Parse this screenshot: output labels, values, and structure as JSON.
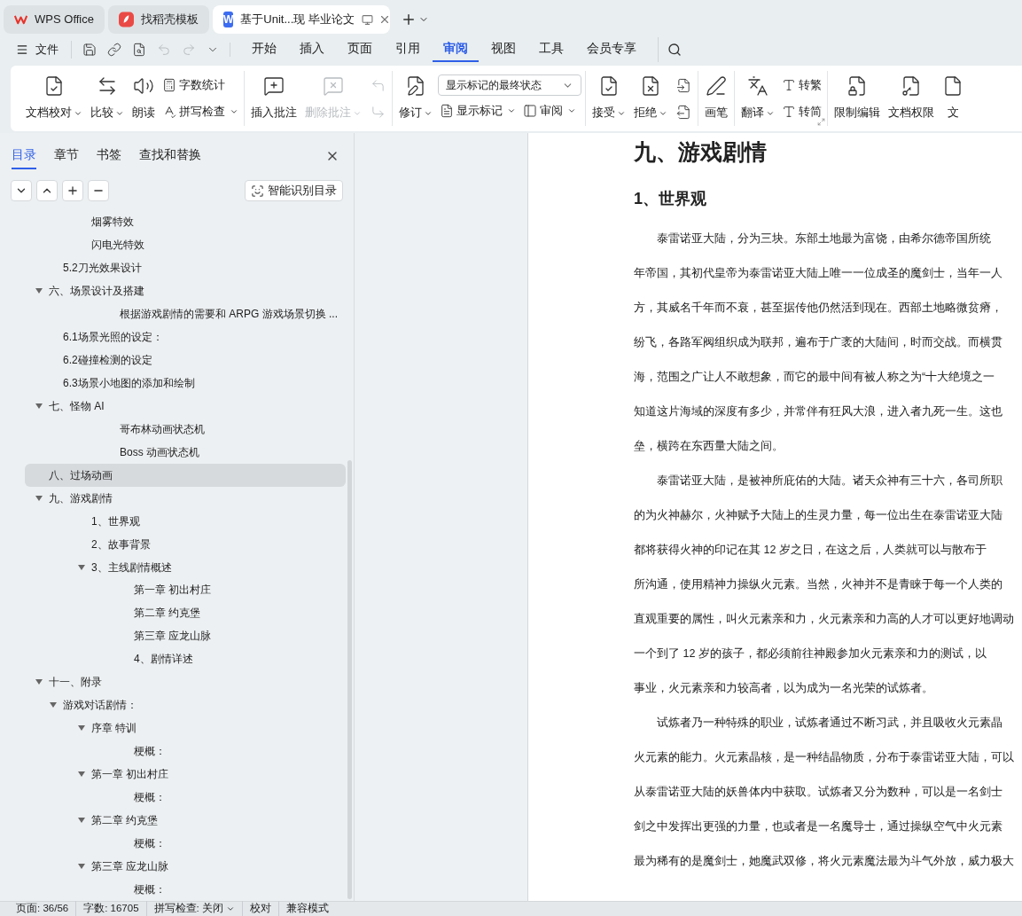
{
  "tabs": [
    {
      "label": "WPS Office",
      "selected": false,
      "kind": "home"
    },
    {
      "label": "找稻壳模板",
      "selected": false,
      "kind": "template"
    },
    {
      "label": "基于Unit...现 毕业论文",
      "selected": true,
      "kind": "document",
      "badge": "W"
    }
  ],
  "menu": {
    "file": "文件",
    "quick_access": [
      {
        "disabled": false
      },
      {
        "disabled": false
      },
      {
        "disabled": false
      },
      {
        "disabled": true
      },
      {
        "disabled": true
      },
      {
        "disabled": false
      }
    ],
    "tabs": [
      {
        "label": "开始",
        "selected": false
      },
      {
        "label": "插入",
        "selected": false
      },
      {
        "label": "页面",
        "selected": false
      },
      {
        "label": "引用",
        "selected": false
      },
      {
        "label": "审阅",
        "selected": true
      },
      {
        "label": "视图",
        "selected": false
      },
      {
        "label": "工具",
        "selected": false
      },
      {
        "label": "会员专享",
        "selected": false
      }
    ]
  },
  "ribbon": [
    {
      "launcher": false,
      "columns": [
        [
          [
            {
              "kind": "large",
              "label": "文档校对",
              "dropdown": true,
              "disabled": false
            }
          ]
        ],
        [
          [
            {
              "kind": "large",
              "label": "比较",
              "dropdown": true,
              "disabled": false
            }
          ]
        ],
        [
          [
            {
              "kind": "large",
              "label": "朗读",
              "dropdown": false,
              "disabled": false
            }
          ]
        ],
        [
          [
            {
              "kind": "small",
              "label": "字数统计",
              "dropdown": false,
              "disabled": false
            }
          ],
          [
            {
              "kind": "small",
              "label": "拼写检查",
              "dropdown": true,
              "disabled": false
            }
          ]
        ]
      ]
    },
    {
      "launcher": false,
      "columns": [
        [
          [
            {
              "kind": "large",
              "label": "插入批注",
              "dropdown": false,
              "disabled": false
            }
          ]
        ],
        [
          [
            {
              "kind": "large",
              "label": "删除批注",
              "dropdown": true,
              "disabled": true
            }
          ]
        ],
        [
          [
            {
              "kind": "icon",
              "disabled": true
            }
          ],
          [
            {
              "kind": "icon",
              "disabled": true
            }
          ]
        ]
      ]
    },
    {
      "launcher": false,
      "columns": [
        [
          [
            {
              "kind": "large",
              "label": "修订",
              "dropdown": true,
              "disabled": false
            }
          ]
        ],
        [
          [
            {
              "kind": "select",
              "value": "显示标记的最终状态"
            }
          ],
          [
            {
              "kind": "small",
              "label": "显示标记",
              "dropdown": true,
              "disabled": false
            },
            {
              "kind": "small",
              "label": "审阅",
              "dropdown": true,
              "disabled": false
            }
          ]
        ]
      ]
    },
    {
      "launcher": false,
      "columns": [
        [
          [
            {
              "kind": "large",
              "label": "接受",
              "dropdown": true,
              "disabled": false
            }
          ]
        ],
        [
          [
            {
              "kind": "large",
              "label": "拒绝",
              "dropdown": true,
              "disabled": false
            }
          ]
        ],
        [
          [
            {
              "kind": "icon",
              "disabled": false
            }
          ],
          [
            {
              "kind": "icon",
              "disabled": false
            }
          ]
        ]
      ]
    },
    {
      "launcher": false,
      "columns": [
        [
          [
            {
              "kind": "large",
              "label": "画笔",
              "dropdown": false,
              "disabled": false
            }
          ]
        ]
      ]
    },
    {
      "launcher": true,
      "columns": [
        [
          [
            {
              "kind": "large",
              "label": "翻译",
              "dropdown": true,
              "disabled": false
            }
          ]
        ],
        [
          [
            {
              "kind": "small",
              "label": "转繁",
              "dropdown": false,
              "disabled": false
            }
          ],
          [
            {
              "kind": "small",
              "label": "转简",
              "dropdown": false,
              "disabled": false
            }
          ]
        ]
      ]
    },
    {
      "launcher": false,
      "columns": [
        [
          [
            {
              "kind": "large",
              "label": "限制编辑",
              "dropdown": false,
              "disabled": false
            }
          ]
        ],
        [
          [
            {
              "kind": "large",
              "label": "文档权限",
              "dropdown": false,
              "disabled": false
            }
          ]
        ],
        [
          [
            {
              "kind": "large",
              "label": "文",
              "dropdown": false,
              "disabled": false
            }
          ]
        ]
      ]
    }
  ],
  "sidebar": {
    "tabs": [
      {
        "label": "目录",
        "selected": true
      },
      {
        "label": "章节",
        "selected": false
      },
      {
        "label": "书签",
        "selected": false
      },
      {
        "label": "查找和替换",
        "selected": false
      }
    ],
    "smart_toc_button": "智能识别目录",
    "outline": [
      {
        "children": [
          {
            "children": [
              {
                "children": [
                  {
                    "label": "烟雾特效",
                    "selected": false
                  },
                  {
                    "label": "闪电光特效",
                    "selected": false
                  }
                ]
              }
            ]
          },
          {
            "label": "5.2刀光效果设计",
            "selected": false
          }
        ]
      },
      {
        "label": "六、场景设计及搭建",
        "selected": false,
        "expanded": true,
        "children": [
          {
            "children": [
              {
                "children": [
                  {
                    "children": [
                      {
                        "children": [
                          {
                            "label": "根据游戏剧情的需要和 ARPG 游戏场景切换 ...",
                            "selected": false
                          }
                        ]
                      }
                    ]
                  }
                ]
              }
            ]
          },
          {
            "label": "6.1场景光照的设定：",
            "selected": false
          },
          {
            "label": "6.2碰撞检测的设定",
            "selected": false
          },
          {
            "label": "6.3场景小地图的添加和绘制",
            "selected": false
          }
        ]
      },
      {
        "label": "七、怪物 AI",
        "selected": false,
        "expanded": true,
        "children": [
          {
            "children": [
              {
                "children": [
                  {
                    "children": [
                      {
                        "children": [
                          {
                            "label": "哥布林动画状态机",
                            "selected": false
                          },
                          {
                            "label": "Boss 动画状态机",
                            "selected": false
                          }
                        ]
                      }
                    ]
                  }
                ]
              }
            ]
          }
        ]
      },
      {
        "label": "八、过场动画",
        "selected": true
      },
      {
        "label": "九、游戏剧情",
        "selected": false,
        "expanded": true,
        "children": [
          {
            "children": [
              {
                "children": [
                  {
                    "label": "1、世界观",
                    "selected": false
                  },
                  {
                    "label": "2、故事背景",
                    "selected": false
                  },
                  {
                    "label": "3、主线剧情概述",
                    "selected": false,
                    "expanded": true,
                    "children": [
                      {
                        "children": [
                          {
                            "children": [
                              {
                                "label": "第一章 初出村庄",
                                "selected": false
                              },
                              {
                                "label": "第二章 约克堡",
                                "selected": false
                              },
                              {
                                "label": "第三章 应龙山脉",
                                "selected": false
                              },
                              {
                                "label": "4、剧情详述",
                                "selected": false
                              }
                            ]
                          }
                        ]
                      }
                    ]
                  }
                ]
              }
            ]
          }
        ]
      },
      {
        "label": "十一、附录",
        "selected": false,
        "expanded": true,
        "children": [
          {
            "label": "游戏对话剧情：",
            "selected": false,
            "expanded": true,
            "children": [
              {
                "children": [
                  {
                    "label": "序章 特训",
                    "selected": false,
                    "expanded": true,
                    "children": [
                      {
                        "children": [
                          {
                            "children": [
                              {
                                "label": "梗概：",
                                "selected": false
                              }
                            ]
                          }
                        ]
                      }
                    ]
                  },
                  {
                    "label": "第一章 初出村庄",
                    "selected": false,
                    "expanded": true,
                    "children": [
                      {
                        "children": [
                          {
                            "children": [
                              {
                                "label": "梗概：",
                                "selected": false
                              }
                            ]
                          }
                        ]
                      }
                    ]
                  },
                  {
                    "label": "第二章 约克堡",
                    "selected": false,
                    "expanded": true,
                    "children": [
                      {
                        "children": [
                          {
                            "children": [
                              {
                                "label": "梗概：",
                                "selected": false
                              }
                            ]
                          }
                        ]
                      }
                    ]
                  },
                  {
                    "label": "第三章 应龙山脉",
                    "selected": false,
                    "expanded": true,
                    "children": [
                      {
                        "children": [
                          {
                            "children": [
                              {
                                "label": "梗概：",
                                "selected": false
                              }
                            ]
                          }
                        ]
                      }
                    ]
                  }
                ]
              }
            ]
          }
        ]
      }
    ]
  },
  "document": {
    "heading": "九、游戏剧情",
    "subheading": "1、世界观",
    "paragraphs": [
      [
        "泰雷诺亚大陆，分为三块。东部土地最为富饶，由希尔德帝国所统",
        "年帝国，其初代皇帝为泰雷诺亚大陆上唯一一位成圣的魔剑士，当年一人",
        "方，其威名千年而不衰，甚至据传他仍然活到现在。西部土地略微贫瘠，",
        "纷飞，各路军阀组织成为联邦，遍布于广袤的大陆间，时而交战。而横贯",
        "海，范围之广让人不敢想象，而它的最中间有被人称之为“十大绝境之一",
        "知道这片海域的深度有多少，并常伴有狂风大浪，进入者九死一生。这也",
        "垒，横跨在东西量大陆之间。"
      ],
      [
        "泰雷诺亚大陆，是被神所庇佑的大陆。诸天众神有三十六，各司所职",
        "的为火神赫尔，火神赋予大陆上的生灵力量，每一位出生在泰雷诺亚大陆",
        "都将获得火神的印记在其 12 岁之日，在这之后，人类就可以与散布于",
        "所沟通，使用精神力操纵火元素。当然，火神并不是青睐于每一个人类的",
        "直观重要的属性，叫火元素亲和力，火元素亲和力高的人才可以更好地调动",
        "一个到了 12 岁的孩子，都必须前往神殿参加火元素亲和力的测试，以",
        "事业，火元素亲和力较高者，以为成为一名光荣的试炼者。"
      ],
      [
        "试炼者乃一种特殊的职业，试炼者通过不断习武，并且吸收火元素晶",
        "火元素的能力。火元素晶核，是一种结晶物质，分布于泰雷诺亚大陆，可以",
        "从泰雷诺亚大陆的妖兽体内中获取。试炼者又分为数种，可以是一名剑士",
        "剑之中发挥出更强的力量，也或者是一名魔导士，通过操纵空气中火元素",
        "最为稀有的是魔剑士，她魔武双修，将火元素魔法最为斗气外放，威力极大"
      ]
    ]
  },
  "status_bar": [
    {
      "label": "页面: 36/56",
      "dropdown": false
    },
    {
      "label": "字数: 16705",
      "dropdown": false
    },
    {
      "label": "拼写检查: 关闭",
      "dropdown": true
    },
    {
      "label": "校对",
      "dropdown": false
    },
    {
      "label": "兼容模式",
      "dropdown": false
    }
  ]
}
